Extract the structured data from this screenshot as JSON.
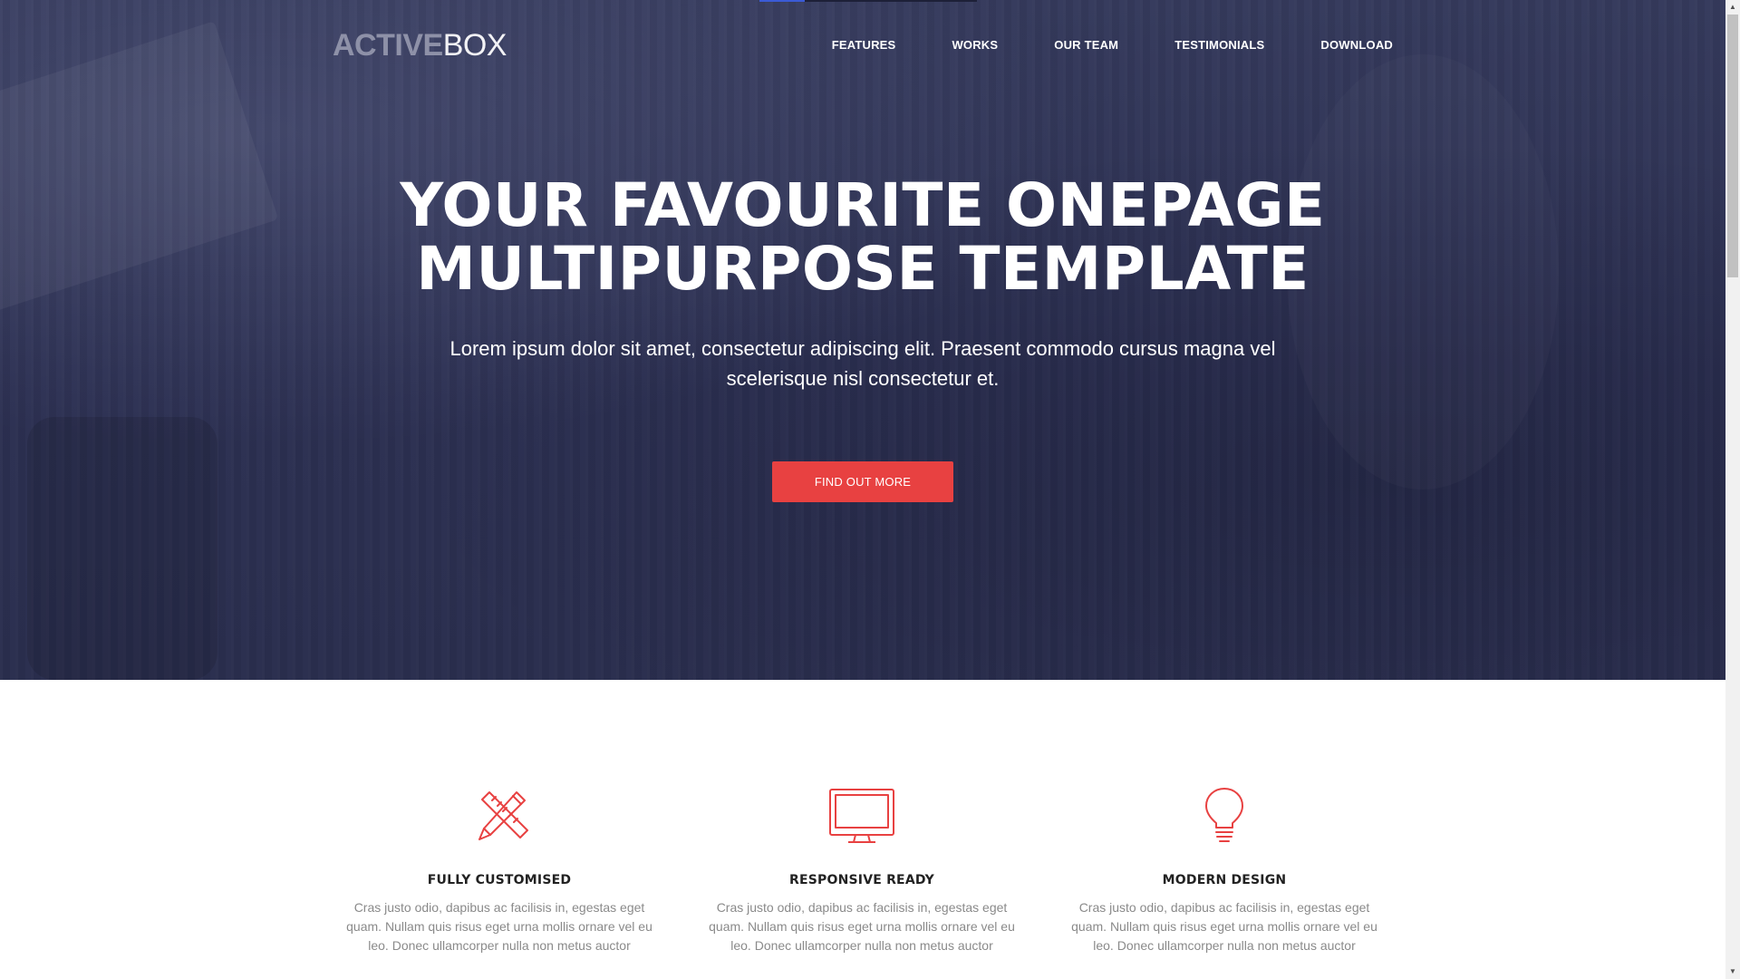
{
  "brand": {
    "logo_bold": "ACTIVE",
    "logo_light": "BOX"
  },
  "nav": {
    "items": [
      "FEATURES",
      "WORKS",
      "OUR TEAM",
      "TESTIMONIALS",
      "DOWNLOAD"
    ]
  },
  "hero": {
    "title_line1": "YOUR FAVOURITE ONEPAGE",
    "title_line2": "MULTIPURPOSE TEMPLATE",
    "subtitle": "Lorem ipsum dolor sit amet, consectetur adipiscing elit. Praesent commodo cursus magna vel scelerisque nisl consectetur et.",
    "cta_label": "FIND OUT MORE"
  },
  "features": [
    {
      "icon": "pencil-ruler-icon",
      "title": "FULLY CUSTOMISED",
      "text": "Cras justo odio, dapibus ac facilisis in, egestas eget quam. Nullam quis risus eget urna mollis ornare vel eu leo. Donec ullamcorper nulla non metus auctor"
    },
    {
      "icon": "monitor-icon",
      "title": "RESPONSIVE READY",
      "text": "Cras justo odio, dapibus ac facilisis in, egestas eget quam. Nullam quis risus eget urna mollis ornare vel eu leo. Donec ullamcorper nulla non metus auctor"
    },
    {
      "icon": "lightbulb-icon",
      "title": "MODERN DESIGN",
      "text": "Cras justo odio, dapibus ac facilisis in, egestas eget quam. Nullam quis risus eget urna mollis ornare vel eu leo. Donec ullamcorper nulla non metus auctor"
    }
  ],
  "colors": {
    "accent": "#e84141",
    "hero_bg": "#2e3254",
    "heading": "#222222",
    "muted": "#8a8a8a"
  }
}
